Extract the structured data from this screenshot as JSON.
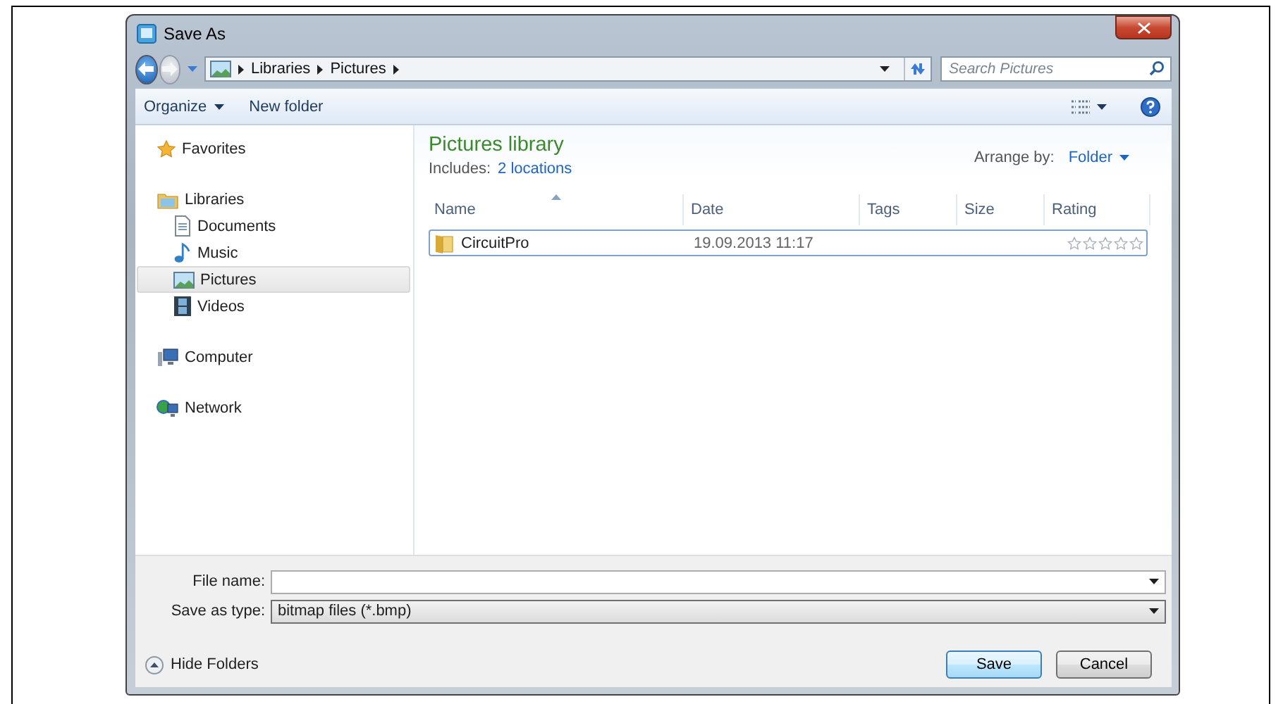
{
  "window": {
    "title": "Save As"
  },
  "address": {
    "crumbs": [
      "Libraries",
      "Pictures"
    ]
  },
  "search": {
    "placeholder": "Search Pictures"
  },
  "toolbar": {
    "organize": "Organize",
    "new_folder": "New folder"
  },
  "nav": [
    {
      "label": "Favorites",
      "kind": "favorites",
      "selected": false
    },
    {
      "label": "Libraries",
      "kind": "library",
      "selected": false,
      "children": [
        {
          "label": "Documents",
          "kind": "document",
          "selected": false
        },
        {
          "label": "Music",
          "kind": "music",
          "selected": false
        },
        {
          "label": "Pictures",
          "kind": "pictures",
          "selected": true
        },
        {
          "label": "Videos",
          "kind": "video",
          "selected": false
        }
      ]
    },
    {
      "label": "Computer",
      "kind": "computer",
      "selected": false
    },
    {
      "label": "Network",
      "kind": "network",
      "selected": false
    }
  ],
  "library": {
    "title": "Pictures library",
    "includes_label": "Includes:",
    "includes_link": "2 locations",
    "arrange_label": "Arrange by:",
    "arrange_value": "Folder"
  },
  "table": {
    "columns": [
      {
        "label": "Name",
        "sorted": true
      },
      {
        "label": "Date",
        "sorted": false
      },
      {
        "label": "Tags",
        "sorted": false
      },
      {
        "label": "Size",
        "sorted": false
      },
      {
        "label": "Rating",
        "sorted": false
      }
    ],
    "rows": [
      {
        "name": "CircuitPro",
        "date": "19.09.2013 11:17",
        "stars": 0,
        "focused": true
      }
    ]
  },
  "file_name": {
    "label": "File name:"
  },
  "save_type": {
    "label": "Save as type:",
    "value": "bitmap files (*.bmp)"
  },
  "hide_folders": "Hide Folders",
  "buttons": [
    {
      "label": "Save",
      "default": true
    },
    {
      "label": "Cancel",
      "default": false
    }
  ]
}
